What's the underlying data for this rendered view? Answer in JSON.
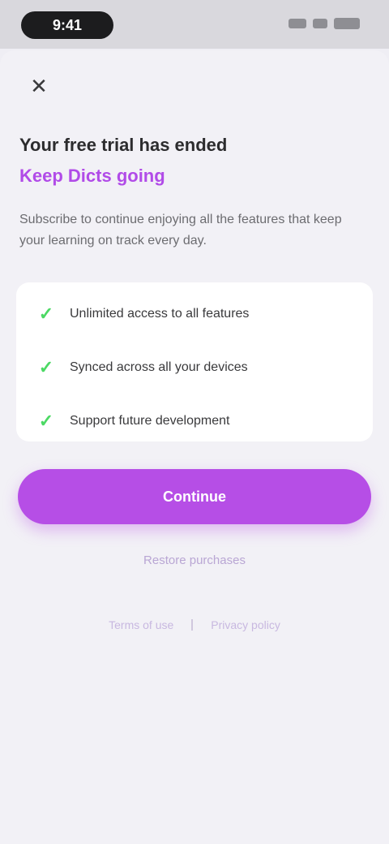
{
  "status_bar": {
    "time": "9:41"
  },
  "sheet": {
    "close_icon": "✕",
    "title": "Your free trial has ended",
    "subtitle": "Keep Dicts going",
    "description": "Subscribe to continue enjoying all the features that keep your learning on track every day.",
    "features": [
      {
        "icon": "check-icon",
        "glyph": "✓",
        "text": "Unlimited access to all features"
      },
      {
        "icon": "check-icon",
        "glyph": "✓",
        "text": "Synced across all your devices"
      },
      {
        "icon": "check-icon",
        "glyph": "✓",
        "text": "Support future development"
      }
    ],
    "primary_button": "Continue",
    "secondary_link": "Restore purchases",
    "footer": {
      "terms": "Terms of use",
      "privacy": "Privacy policy"
    }
  },
  "colors": {
    "accent": "#b64ee6",
    "check": "#4cd964",
    "background": "#f2f1f6"
  }
}
